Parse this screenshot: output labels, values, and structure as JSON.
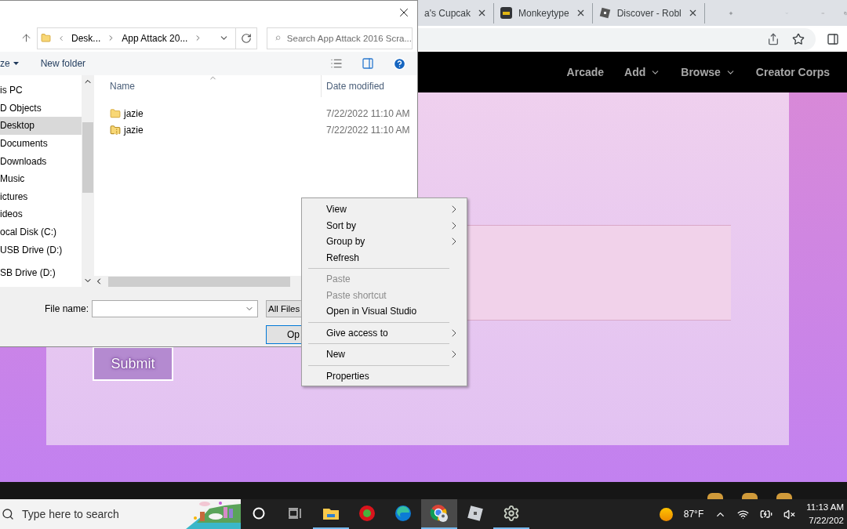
{
  "browser": {
    "tabs": [
      {
        "label": "a's Cupcak",
        "kind": "plain",
        "selected": false
      },
      {
        "label": "Monkeytype",
        "kind": "monkeytype",
        "selected": false
      },
      {
        "label": "Discover - Robl",
        "kind": "roblox",
        "selected": false
      }
    ],
    "nav": [
      {
        "label": "Arcade",
        "has_menu": false
      },
      {
        "label": "Add",
        "has_menu": true
      },
      {
        "label": "Browse",
        "has_menu": true
      },
      {
        "label": "Creator Corps",
        "has_menu": false
      }
    ],
    "submit": "Submit"
  },
  "dialog": {
    "breadcrumb": [
      "Desk...",
      "App Attack 20..."
    ],
    "search_placeholder": "Search App Attack 2016 Scra...",
    "organize": "ze",
    "new_folder": "New folder",
    "sidebar": [
      {
        "label": "is PC",
        "selected": false
      },
      {
        "label": "D Objects",
        "selected": false
      },
      {
        "label": "Desktop",
        "selected": true
      },
      {
        "label": "Documents",
        "selected": false
      },
      {
        "label": "Downloads",
        "selected": false
      },
      {
        "label": "Music",
        "selected": false
      },
      {
        "label": "ictures",
        "selected": false
      },
      {
        "label": "ideos",
        "selected": false
      },
      {
        "label": "ocal Disk (C:)",
        "selected": false
      },
      {
        "label": "USB Drive (D:)",
        "selected": false
      },
      {
        "label": "SB Drive (D:)",
        "selected": false
      }
    ],
    "columns": [
      "Name",
      "Date modified"
    ],
    "files": [
      {
        "name": "jazie",
        "kind": "folder",
        "modified": "7/22/2022 11:10 AM"
      },
      {
        "name": "jazie",
        "kind": "zip",
        "modified": "7/22/2022 11:10 AM"
      }
    ],
    "file_name_label": "File name:",
    "file_type": "All Files",
    "open_button": "Op"
  },
  "context_menu": [
    {
      "kind": "item",
      "label": "View",
      "submenu": true,
      "disabled": false
    },
    {
      "kind": "item",
      "label": "Sort by",
      "submenu": true,
      "disabled": false
    },
    {
      "kind": "item",
      "label": "Group by",
      "submenu": true,
      "disabled": false
    },
    {
      "kind": "item",
      "label": "Refresh",
      "submenu": false,
      "disabled": false
    },
    {
      "kind": "separator"
    },
    {
      "kind": "item",
      "label": "Paste",
      "submenu": false,
      "disabled": true
    },
    {
      "kind": "item",
      "label": "Paste shortcut",
      "submenu": false,
      "disabled": true
    },
    {
      "kind": "item",
      "label": "Open in Visual Studio",
      "submenu": false,
      "disabled": false
    },
    {
      "kind": "separator"
    },
    {
      "kind": "item",
      "label": "Give access to",
      "submenu": true,
      "disabled": false
    },
    {
      "kind": "separator"
    },
    {
      "kind": "item",
      "label": "New",
      "submenu": true,
      "disabled": false
    },
    {
      "kind": "separator"
    },
    {
      "kind": "item",
      "label": "Properties",
      "submenu": false,
      "disabled": false
    }
  ],
  "taskbar": {
    "search_placeholder": "Type here to search",
    "apps": [
      {
        "kind": "cortana",
        "running": false,
        "selected": false
      },
      {
        "kind": "taskview",
        "running": false,
        "selected": false
      },
      {
        "kind": "explorer",
        "running": true,
        "selected": false
      },
      {
        "kind": "redball",
        "running": false,
        "selected": false
      },
      {
        "kind": "edge",
        "running": false,
        "selected": false
      },
      {
        "kind": "chrome",
        "running": true,
        "selected": true
      },
      {
        "kind": "roblox",
        "running": false,
        "selected": false
      },
      {
        "kind": "gear",
        "running": true,
        "selected": false
      }
    ],
    "weather": "87°F",
    "time": "11:13 AM",
    "date": "7/22/202"
  }
}
